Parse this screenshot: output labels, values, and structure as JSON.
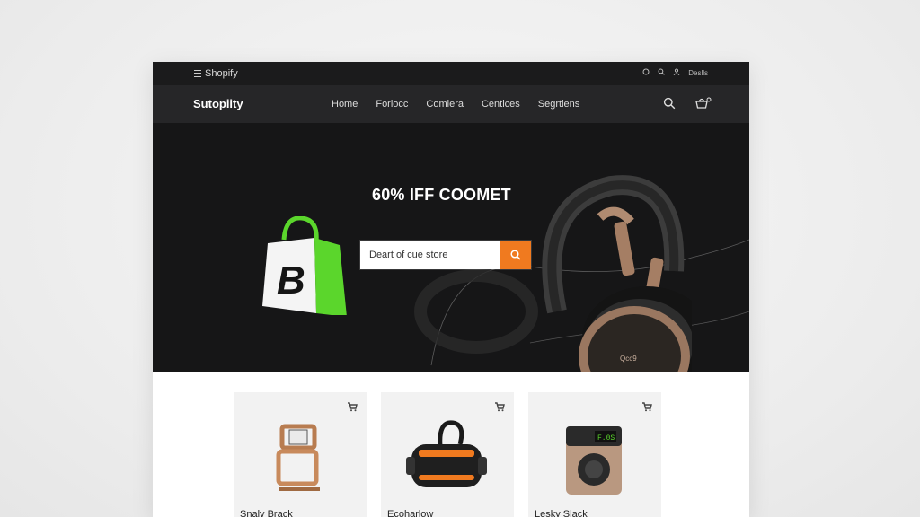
{
  "topbar": {
    "menu_label": "Shopify",
    "util_text": "Deslls"
  },
  "nav": {
    "brand": "Sutopiity",
    "links": [
      "Home",
      "Forlocc",
      "Comlera",
      "Centices",
      "Segrtiens"
    ]
  },
  "hero": {
    "headline": "60% IFF COOMET",
    "search_placeholder": "Deart of cue store",
    "bag_letter": "B",
    "headphone_brand": "Qcc9"
  },
  "products": [
    {
      "name": "Snaly Brack"
    },
    {
      "name": "Ecoharlow"
    },
    {
      "name": "Lesky Slack"
    }
  ],
  "product_screen_text": "F.0S",
  "colors": {
    "accent": "#f07a1f",
    "bag_green": "#5bd62c",
    "dark_bg": "#161617",
    "nav_bg": "#262628"
  },
  "icons": [
    "menu-icon",
    "search-icon",
    "cart-icon",
    "shopping-bag-logo-icon",
    "headphones-image",
    "add-to-cart-icon"
  ]
}
